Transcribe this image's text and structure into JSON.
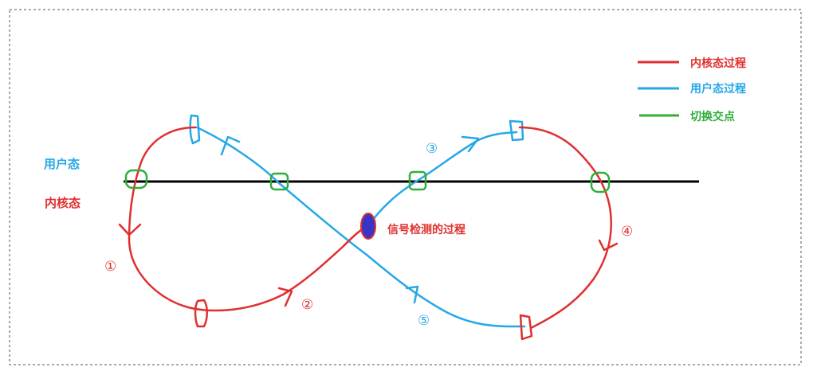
{
  "colors": {
    "kernel": "#e02f2f",
    "user": "#26a8e6",
    "switch": "#2fae3a",
    "signal": "#3a33c6",
    "boundary": "#000000",
    "border": "#555555"
  },
  "legend": {
    "kernel_label": "内核态过程",
    "user_label": "用户态过程",
    "switch_label": "切换交点"
  },
  "zones": {
    "user_mode": "用户态",
    "kernel_mode": "内核态"
  },
  "signal_label": "信号检测的过程",
  "steps": [
    "①",
    "②",
    "③",
    "④",
    "⑤"
  ]
}
